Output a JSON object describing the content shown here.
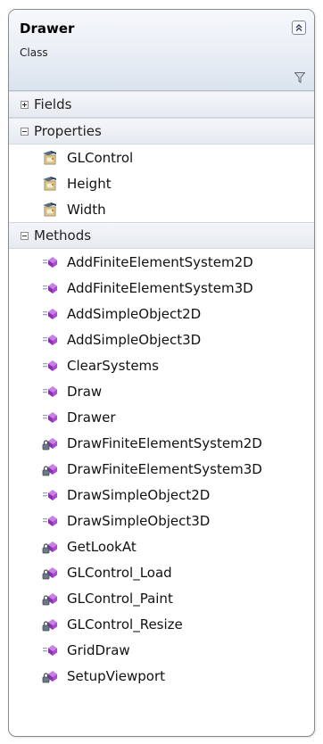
{
  "class": {
    "name": "Drawer",
    "kind": "Class"
  },
  "sections": {
    "fields": {
      "label": "Fields"
    },
    "properties": {
      "label": "Properties",
      "items": [
        {
          "label": "GLControl",
          "icon": "property-icon"
        },
        {
          "label": "Height",
          "icon": "property-icon"
        },
        {
          "label": "Width",
          "icon": "property-icon"
        }
      ]
    },
    "methods": {
      "label": "Methods",
      "items": [
        {
          "label": "AddFiniteElementSystem2D",
          "icon": "public-method-icon"
        },
        {
          "label": "AddFiniteElementSystem3D",
          "icon": "public-method-icon"
        },
        {
          "label": "AddSimpleObject2D",
          "icon": "public-method-icon"
        },
        {
          "label": "AddSimpleObject3D",
          "icon": "public-method-icon"
        },
        {
          "label": "ClearSystems",
          "icon": "public-method-icon"
        },
        {
          "label": "Draw",
          "icon": "public-method-icon"
        },
        {
          "label": "Drawer",
          "icon": "public-method-icon"
        },
        {
          "label": "DrawFiniteElementSystem2D",
          "icon": "private-method-icon"
        },
        {
          "label": "DrawFiniteElementSystem3D",
          "icon": "private-method-icon"
        },
        {
          "label": "DrawSimpleObject2D",
          "icon": "public-method-icon"
        },
        {
          "label": "DrawSimpleObject3D",
          "icon": "public-method-icon"
        },
        {
          "label": "GetLookAt",
          "icon": "private-method-icon"
        },
        {
          "label": "GLControl_Load",
          "icon": "private-method-icon"
        },
        {
          "label": "GLControl_Paint",
          "icon": "private-method-icon"
        },
        {
          "label": "GLControl_Resize",
          "icon": "private-method-icon"
        },
        {
          "label": "GridDraw",
          "icon": "public-method-icon"
        },
        {
          "label": "SetupViewport",
          "icon": "private-method-icon"
        }
      ]
    }
  },
  "colors": {
    "method": "#a040c8",
    "property": "#e0a020",
    "header": "#e8edf5"
  }
}
